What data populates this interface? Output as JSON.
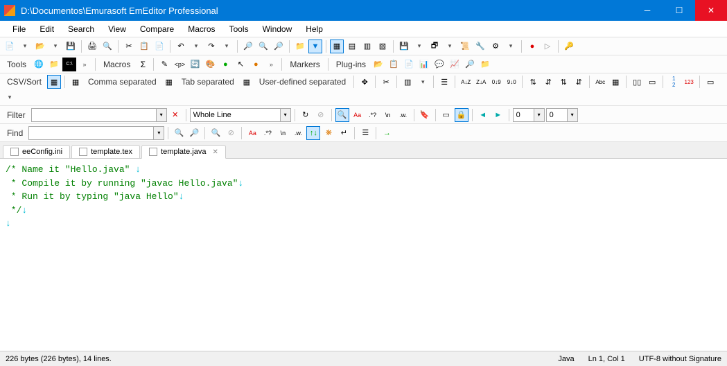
{
  "title": "D:\\Documentos\\Emurasoft EmEditor Professional",
  "menu": [
    "File",
    "Edit",
    "Search",
    "View",
    "Compare",
    "Macros",
    "Tools",
    "Window",
    "Help"
  ],
  "toolbar3": {
    "tools_label": "Tools",
    "macros_label": "Macros",
    "sigma": "Σ",
    "markers_label": "Markers",
    "plugins_label": "Plug-ins"
  },
  "toolbar4": {
    "csv_label": "CSV/Sort",
    "comma": "Comma separated",
    "tab": "Tab separated",
    "user": "User-defined separated"
  },
  "toolbar5": {
    "filter_label": "Filter",
    "whole_line": "Whole Line",
    "num0a": "0",
    "num0b": "0"
  },
  "toolbar6": {
    "find_label": "Find"
  },
  "tabs": [
    {
      "name": "eeConfig.ini",
      "active": false,
      "closable": false
    },
    {
      "name": "template.tex",
      "active": false,
      "closable": false
    },
    {
      "name": "template.java",
      "active": true,
      "closable": true
    }
  ],
  "code": [
    "/* Name it \"Hello.java\" ",
    " * Compile it by running \"javac Hello.java\"",
    " * Run it by typing \"java Hello\"",
    " */",
    ""
  ],
  "status": {
    "left": "226 bytes (226 bytes), 14 lines.",
    "lang": "Java",
    "pos": "Ln 1, Col 1",
    "enc": "UTF-8 without Signature"
  }
}
